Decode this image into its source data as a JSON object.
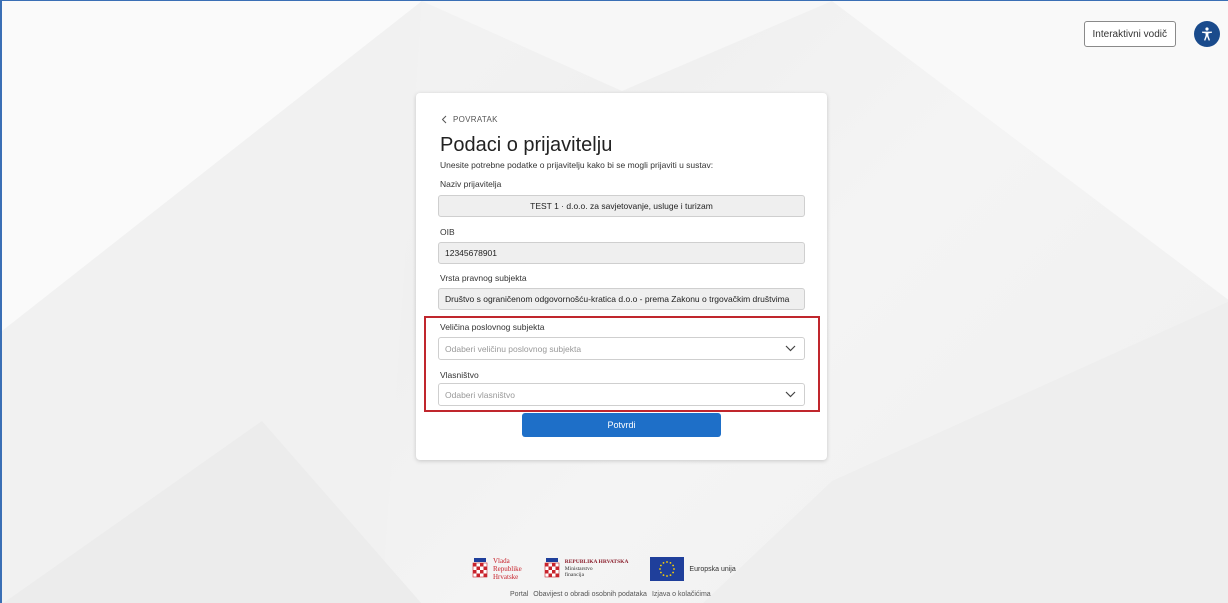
{
  "header": {
    "guide_label": "Interaktivni vodič",
    "accessibility_icon": "accessibility-icon"
  },
  "form": {
    "back_label": "POVRATAK",
    "title": "Podaci o prijavitelju",
    "subtitle": "Unesite potrebne podatke o prijavitelju kako bi se mogli prijaviti u sustav:",
    "fields": {
      "name_label": "Naziv prijavitelja",
      "name_value": "TEST 1 · d.o.o. za savjetovanje, usluge i turizam",
      "oib_label": "OIB",
      "oib_value": "12345678901",
      "entity_type_label": "Vrsta pravnog subjekta",
      "entity_type_value": "Društvo s ograničenom odgovornošću-kratica d.o.o - prema Zakonu o trgovačkim društvima",
      "size_label": "Veličina poslovnog subjekta",
      "size_placeholder": "Odaberi veličinu poslovnog subjekta",
      "ownership_label": "Vlasništvo",
      "ownership_placeholder": "Odaberi vlasništvo"
    },
    "submit_label": "Potvrdi"
  },
  "colors": {
    "primary": "#1e6fc8",
    "highlight": "#c0262d",
    "accessibility": "#1a4b8c"
  },
  "footer": {
    "logos": {
      "vlada": [
        "Vlada",
        "Republike",
        "Hrvatske"
      ],
      "ministry": [
        "REPUBLIKA HRVATSKA",
        "Ministarstvo",
        "financija"
      ],
      "eu": "Europska unija"
    },
    "links": [
      "Portal",
      "Obavijest o obradi osobnih podataka",
      "Izjava o kolačićima"
    ]
  }
}
